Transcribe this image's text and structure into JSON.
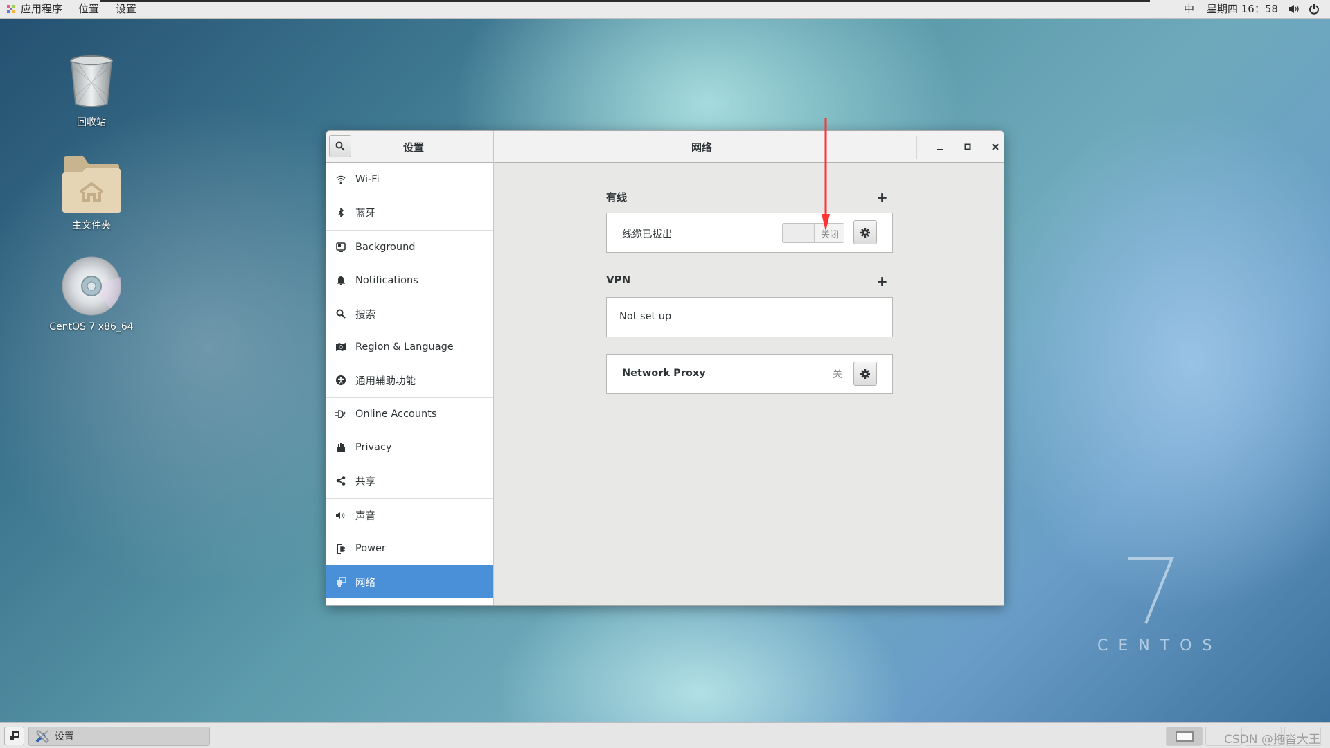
{
  "topbar": {
    "applications": "应用程序",
    "places": "位置",
    "settings": "设置",
    "input_method": "中",
    "clock": "星期四 16：58",
    "volume_icon": "speaker-icon",
    "power_icon": "power-icon"
  },
  "desktop": {
    "icons": [
      {
        "label": "回收站",
        "icon": "trash-icon"
      },
      {
        "label": "主文件夹",
        "icon": "home-folder-icon"
      },
      {
        "label": "CentOS 7 x86_64",
        "icon": "disc-icon"
      }
    ],
    "logo_number": "7",
    "logo_word": "CENTOS"
  },
  "window": {
    "sidebar_title": "设置",
    "main_title": "网络",
    "sidebar": {
      "items": [
        {
          "label": "Wi-Fi",
          "icon": "wifi-icon"
        },
        {
          "label": "蓝牙",
          "icon": "bluetooth-icon"
        },
        {
          "label": "Background",
          "icon": "background-icon"
        },
        {
          "label": "Notifications",
          "icon": "bell-icon"
        },
        {
          "label": "搜索",
          "icon": "search-icon"
        },
        {
          "label": "Region & Language",
          "icon": "region-icon"
        },
        {
          "label": "通用辅助功能",
          "icon": "accessibility-icon"
        },
        {
          "label": "Online Accounts",
          "icon": "online-accounts-icon"
        },
        {
          "label": "Privacy",
          "icon": "hand-icon"
        },
        {
          "label": "共享",
          "icon": "share-icon"
        },
        {
          "label": "声音",
          "icon": "speaker-icon"
        },
        {
          "label": "Power",
          "icon": "power-plug-icon"
        },
        {
          "label": "网络",
          "icon": "network-icon",
          "selected": true
        }
      ]
    },
    "wired": {
      "section_label": "有线",
      "add_label": "+",
      "status": "线缆已拔出",
      "toggle_state": "关闭"
    },
    "vpn": {
      "section_label": "VPN",
      "add_label": "+",
      "status": "Not set up"
    },
    "proxy": {
      "label": "Network Proxy",
      "state": "关"
    }
  },
  "taskbar": {
    "task_label": "设置",
    "watermark": "CSDN @拖沓大王"
  },
  "colors": {
    "selected": "#4a90d9",
    "arrow": "#ff3333"
  }
}
